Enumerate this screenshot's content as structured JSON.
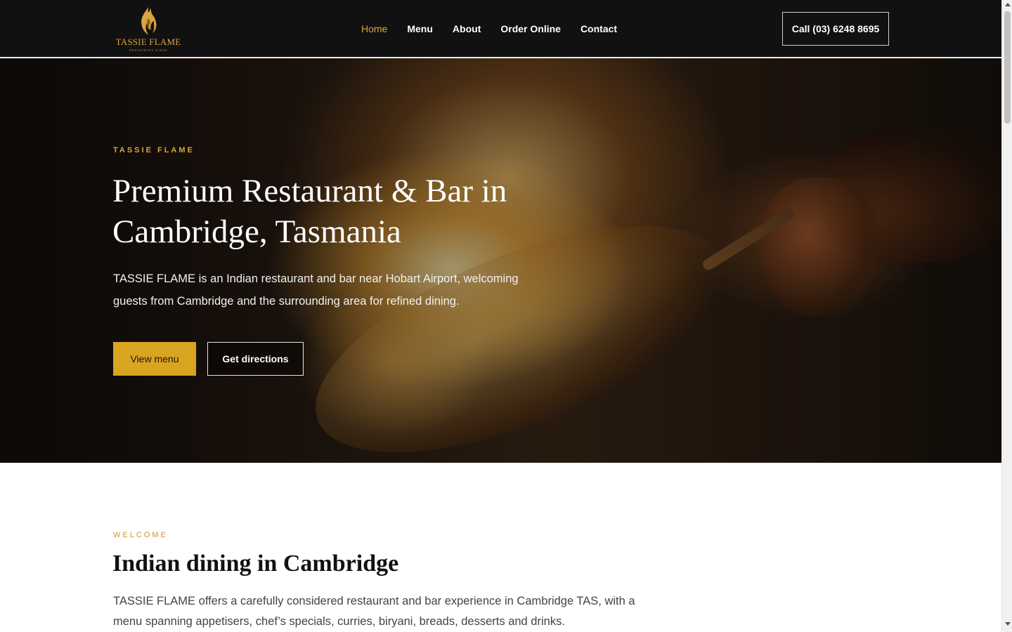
{
  "header": {
    "logo": {
      "title": "TASSIE FLAME",
      "subtitle": "RESTAURANT & BAR",
      "icon": "flame-icon",
      "color": "#d9a441"
    },
    "nav": [
      {
        "label": "Home",
        "active": true
      },
      {
        "label": "Menu",
        "active": false
      },
      {
        "label": "About",
        "active": false
      },
      {
        "label": "Order Online",
        "active": false
      },
      {
        "label": "Contact",
        "active": false
      }
    ],
    "call_button": "Call (03) 6248 8695"
  },
  "hero": {
    "eyebrow": "TASSIE FLAME",
    "title": "Premium Restaurant & Bar in Cambridge, Tasmania",
    "text": "TASSIE FLAME is an Indian restaurant and bar near Hobart Airport, welcoming guests from Cambridge and the surrounding area for refined dining.",
    "primary_button": "View menu",
    "secondary_button": "Get directions"
  },
  "welcome": {
    "eyebrow": "WELCOME",
    "title": "Indian dining in Cambridge",
    "text": "TASSIE FLAME offers a carefully considered restaurant and bar experience in Cambridge TAS, with a menu spanning appetisers, chef’s specials, curries, biryani, breads, desserts and drinks."
  },
  "colors": {
    "accent": "#d9a441",
    "button": "#d9a420",
    "header_bg": "#111111"
  }
}
